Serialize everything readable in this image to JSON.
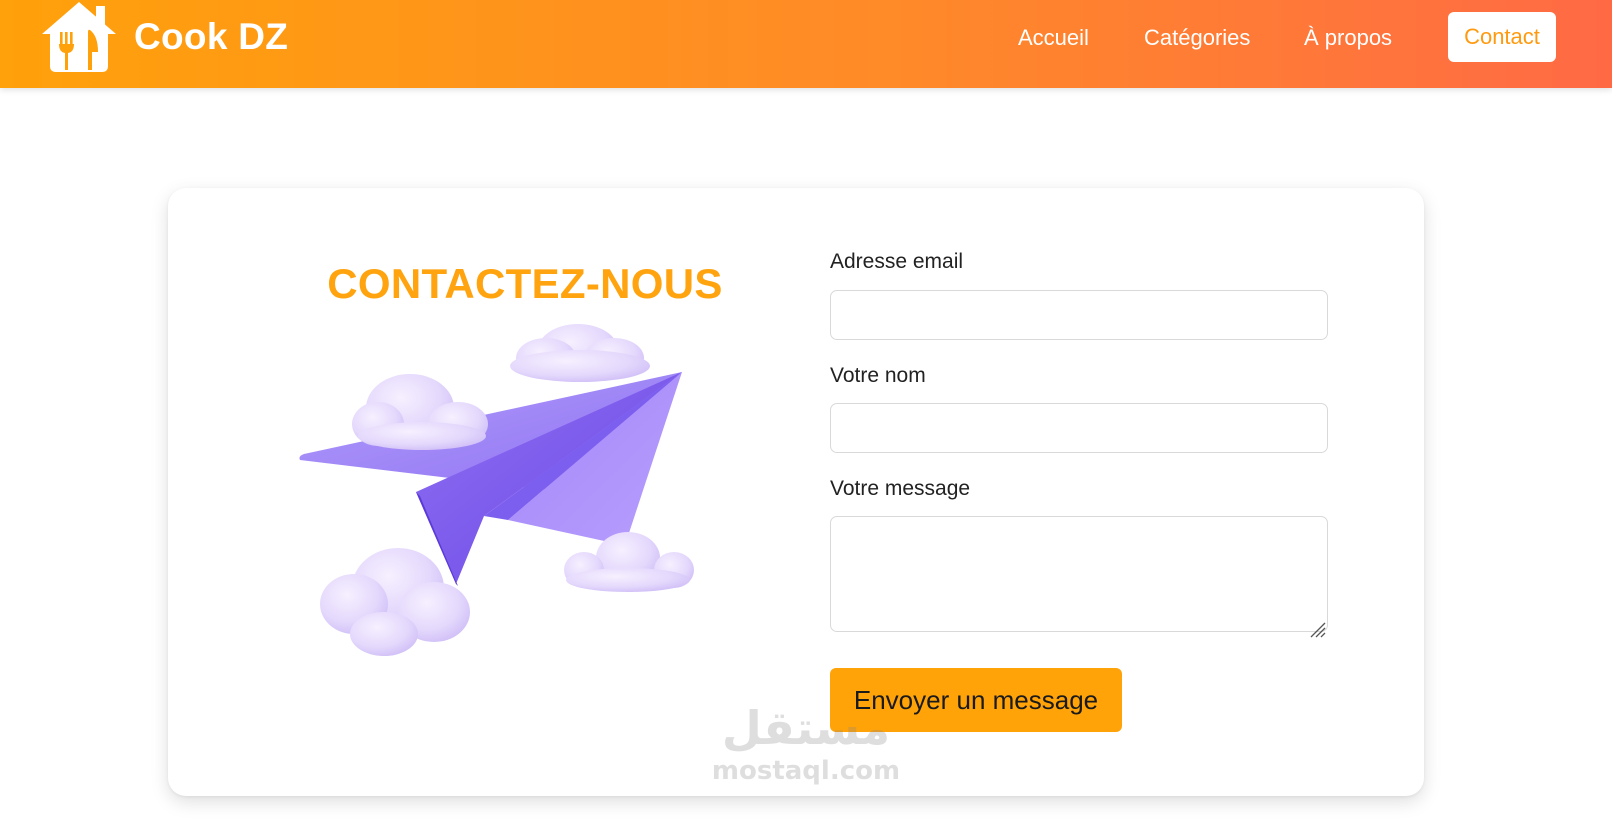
{
  "header": {
    "brand": "Cook DZ",
    "logo_icon": "restaurant-house-cutlery-icon",
    "nav": {
      "home": "Accueil",
      "categories": "Catégories",
      "about": "À propos",
      "contact": "Contact"
    }
  },
  "contact": {
    "title": "CONTACTEZ-NOUS",
    "illustration": "paper-plane-clouds-illustration",
    "email_label": "Adresse email",
    "email_value": "",
    "name_label": "Votre nom",
    "name_value": "",
    "message_label": "Votre message",
    "message_value": "",
    "submit_label": "Envoyer un message"
  },
  "watermark": {
    "arabic": "مستقل",
    "latin": "mostaql.com"
  },
  "colors": {
    "header_gradient_start": "#ffa10a",
    "header_gradient_end": "#ff6a45",
    "accent_orange": "#ffa30f",
    "button_orange": "#ffa308",
    "plane_purple": "#9b7cf5",
    "cloud_lilac": "#e2d6fb"
  }
}
